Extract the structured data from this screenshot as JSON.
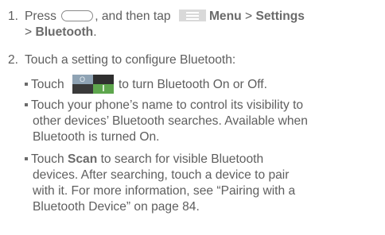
{
  "step1": {
    "num": "1.",
    "part_a": "Press",
    "part_b": ", and then tap",
    "menu": "Menu",
    "gt1": ">",
    "settings": "Settings",
    "gt2": ">",
    "bluetooth": "Bluetooth",
    "period": "."
  },
  "step2": {
    "num": "2.",
    "text": "Touch a setting to configure Bluetooth:"
  },
  "bullet1": {
    "a": "Touch",
    "b": "to turn Bluetooth On or Off."
  },
  "bullet2": {
    "line1": "Touch your phone’s name to control its visibility to",
    "line2": "other devices’ Bluetooth searches. Available when",
    "line3": "Bluetooth is turned On."
  },
  "bullet3": {
    "touch": "Touch",
    "scan": "Scan",
    "line1_rest": "to search for visible Bluetooth",
    "line2": "devices. After searching, touch a device to pair",
    "line3": "with it. For more information, see “Pairing with a",
    "line4": "Bluetooth Device” on page 84."
  },
  "icons": [
    "home-key-icon",
    "menu-icon",
    "bluetooth-toggle-icon"
  ]
}
